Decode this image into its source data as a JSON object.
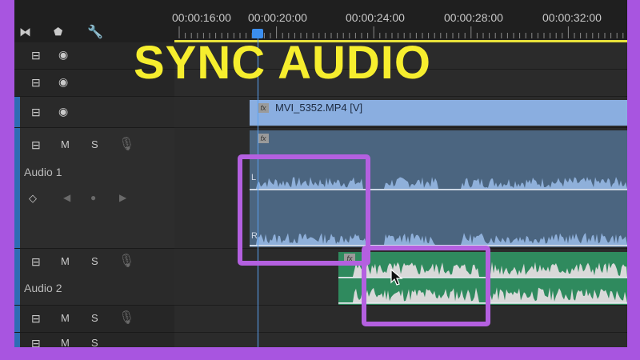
{
  "overlay": {
    "headline": "SYNC AUDIO",
    "headline_color": "#f6ee2e",
    "highlight_color": "#b460e0",
    "border_color": "#a855e0"
  },
  "timeline": {
    "timecodes": [
      "00:00:16:00",
      "00:00:20:00",
      "00:00:24:00",
      "00:00:28:00",
      "00:00:32:00"
    ],
    "toolbar_icons": [
      "snap-icon",
      "marker-icon",
      "wrench-icon"
    ]
  },
  "tracks": [
    {
      "type": "video",
      "icons": [
        "film-icon",
        "eye-icon"
      ]
    },
    {
      "type": "video",
      "icons": [
        "film-icon",
        "eye-icon"
      ]
    },
    {
      "type": "video",
      "icons": [
        "film-icon",
        "eye-icon"
      ]
    },
    {
      "type": "audio",
      "name": "Audio 1",
      "buttons": [
        "M",
        "S"
      ],
      "icons": [
        "film-icon",
        "mic-icon",
        "keyframe-icon"
      ]
    },
    {
      "type": "audio",
      "name": "Audio 2",
      "buttons": [
        "M",
        "S"
      ],
      "icons": [
        "film-icon",
        "mic-icon"
      ]
    },
    {
      "type": "audio",
      "name": "",
      "buttons": [
        "M",
        "S"
      ],
      "icons": [
        "film-icon",
        "mic-icon"
      ]
    },
    {
      "type": "audio",
      "name": "",
      "buttons": [
        "M",
        "S"
      ],
      "icons": [
        "film-icon",
        "mic-icon"
      ]
    }
  ],
  "clips": {
    "video_clip_name": "MVI_5352.MP4 [V]",
    "video_color": "#8aaee0",
    "audio1_color": "#4b6580",
    "audio2_color": "#2f8a5e",
    "fx_label": "fx",
    "channel_left": "L",
    "channel_right": "R"
  }
}
